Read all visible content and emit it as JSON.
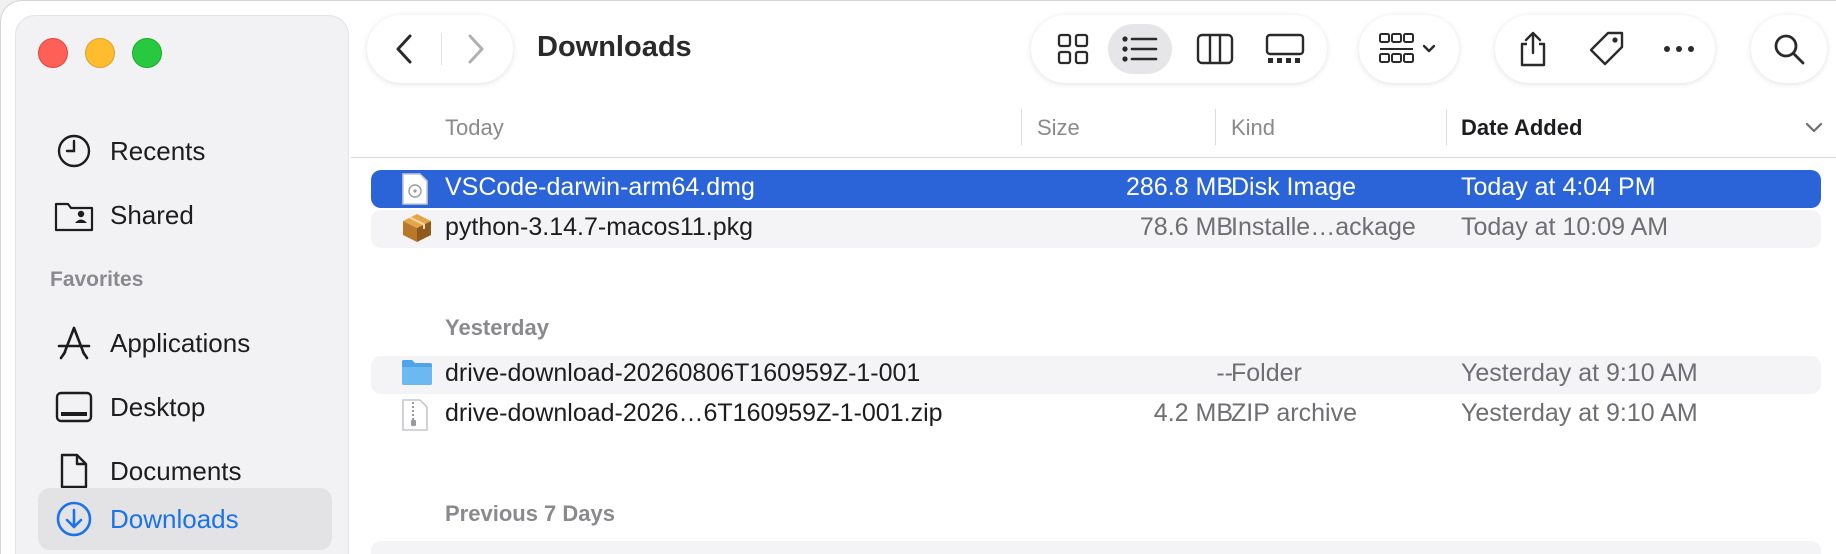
{
  "window": {
    "title": "Downloads"
  },
  "sidebar": {
    "items": [
      {
        "label": "Recents",
        "icon": "clock-icon"
      },
      {
        "label": "Shared",
        "icon": "shared-folder-icon"
      }
    ],
    "favorites_label": "Favorites",
    "favorites": [
      {
        "label": "Applications",
        "icon": "applications-icon"
      },
      {
        "label": "Desktop",
        "icon": "desktop-icon"
      },
      {
        "label": "Documents",
        "icon": "document-icon"
      },
      {
        "label": "Downloads",
        "icon": "download-icon",
        "active": true
      }
    ]
  },
  "columns": {
    "name": "Today",
    "size": "Size",
    "kind": "Kind",
    "date_added": "Date Added"
  },
  "groups": [
    {
      "title": "Today",
      "rows": [
        {
          "name": "VSCode-darwin-arm64.dmg",
          "size": "286.8 MB",
          "kind": "Disk Image",
          "date": "Today at 4:04 PM",
          "icon": "disk-image-icon",
          "selected": true
        },
        {
          "name": "python-3.14.7-macos11.pkg",
          "size": "78.6 MB",
          "kind": "Installe…ackage",
          "date": "Today at 10:09 AM",
          "icon": "package-icon"
        }
      ]
    },
    {
      "title": "Yesterday",
      "rows": [
        {
          "name": "drive-download-20260806T160959Z-1-001",
          "size": "--",
          "kind": "Folder",
          "date": "Yesterday at 9:10 AM",
          "icon": "folder-icon"
        },
        {
          "name": "drive-download-2026…6T160959Z-1-001.zip",
          "size": "4.2 MB",
          "kind": "ZIP archive",
          "date": "Yesterday at 9:10 AM",
          "icon": "zip-icon"
        }
      ]
    },
    {
      "title": "Previous 7 Days",
      "rows": []
    }
  ],
  "colors": {
    "accent": "#2b63d9",
    "sidebar_active_text": "#1a73e8"
  }
}
